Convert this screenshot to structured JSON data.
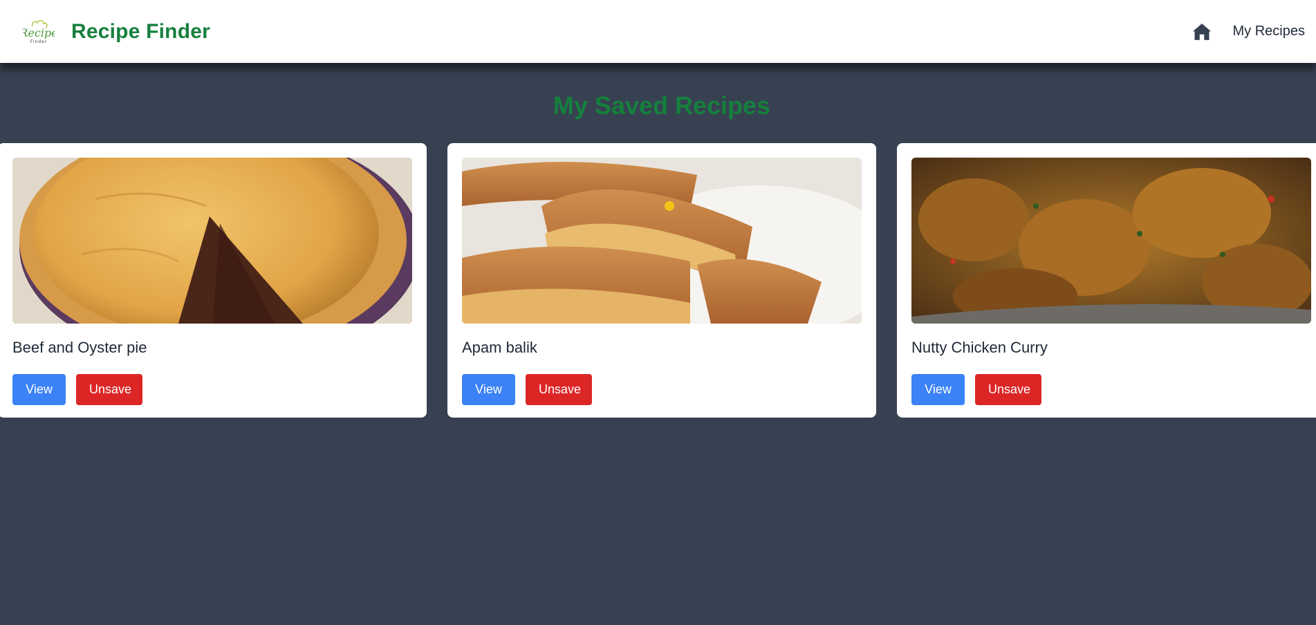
{
  "navbar": {
    "logo_text_top": "Recipe",
    "logo_text_bottom": "Finder",
    "brand_title": "Recipe Finder",
    "home_icon": "home-icon",
    "my_recipes_label": "My Recipes"
  },
  "page": {
    "title": "My Saved Recipes"
  },
  "recipes": [
    {
      "name": "Beef and Oyster pie",
      "view_label": "View",
      "unsave_label": "Unsave"
    },
    {
      "name": "Apam balik",
      "view_label": "View",
      "unsave_label": "Unsave"
    },
    {
      "name": "Nutty Chicken Curry",
      "view_label": "View",
      "unsave_label": "Unsave"
    }
  ],
  "colors": {
    "brand_green": "#15803d",
    "background": "#374151",
    "view_button": "#3b82f6",
    "unsave_button": "#dc2626"
  }
}
